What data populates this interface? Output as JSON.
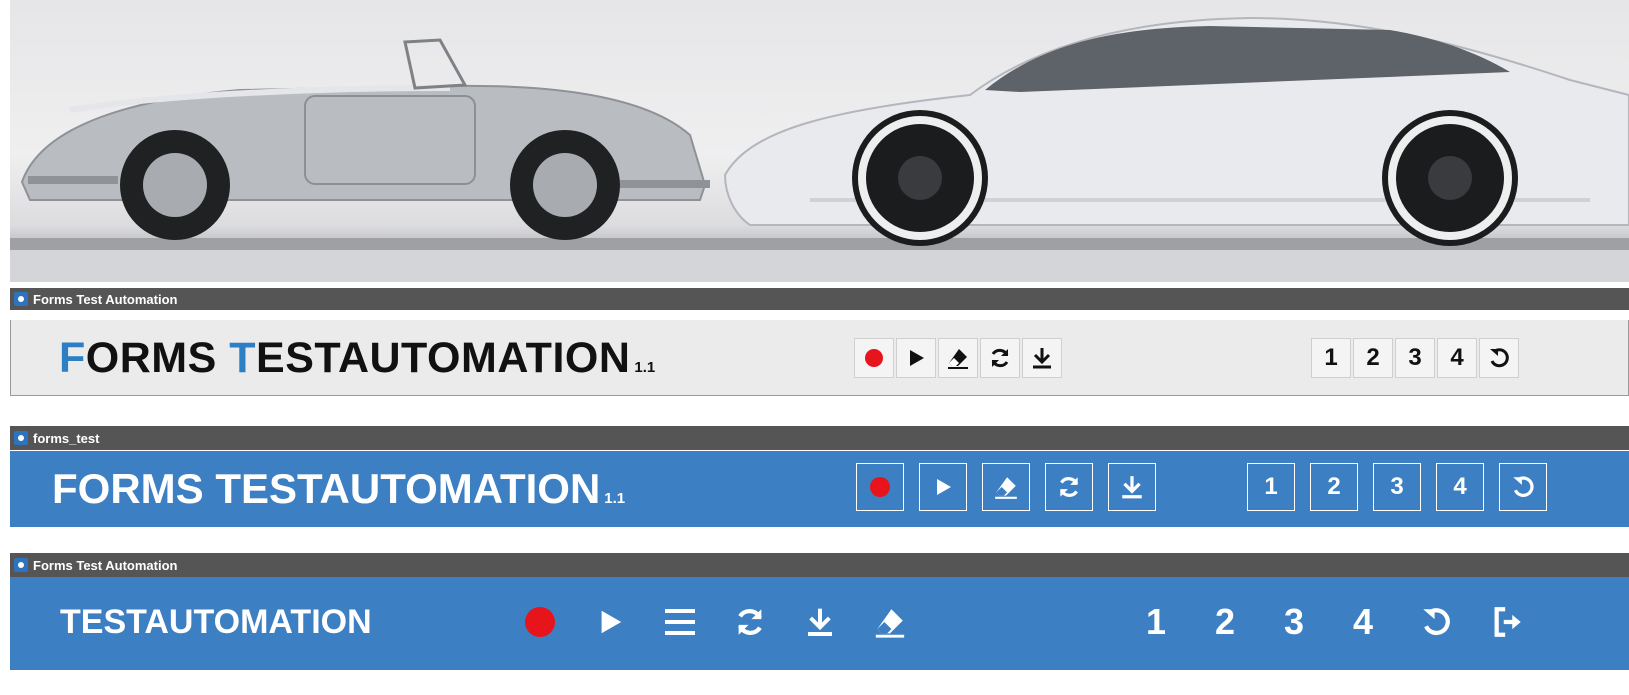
{
  "hero": {
    "description_icon": "car-photo-banner"
  },
  "window1": {
    "title": "Forms Test Automation",
    "heading_first_letter_1": "F",
    "heading_rest_1": "ORMS ",
    "heading_first_letter_2": "T",
    "heading_rest_2": "ESTAUTOMATION",
    "version": "1.1",
    "toolbar_icons": [
      "record-icon",
      "play-icon",
      "eraser-icon",
      "refresh-icon",
      "download-icon"
    ],
    "numbers": [
      "1",
      "2",
      "3",
      "4"
    ],
    "reset_icon": "undo-icon"
  },
  "window2": {
    "title": "forms_test",
    "heading": "FORMS TESTAUTOMATION",
    "version": "1.1",
    "toolbar_icons": [
      "record-icon",
      "play-icon",
      "eraser-icon",
      "refresh-icon",
      "download-icon"
    ],
    "numbers": [
      "1",
      "2",
      "3",
      "4"
    ],
    "reset_icon": "undo-icon"
  },
  "window3": {
    "title": "Forms Test Automation",
    "heading": "TESTAUTOMATION",
    "toolbar_icons": [
      "record-icon",
      "play-icon",
      "menu-icon",
      "refresh-icon",
      "download-icon",
      "eraser-icon"
    ],
    "numbers": [
      "1",
      "2",
      "3",
      "4"
    ],
    "reset_icon": "undo-icon",
    "exit_icon": "logout-icon"
  },
  "colors": {
    "accent_blue": "#2c7fc3",
    "panel_blue": "#3d7fc3",
    "titlebar": "#555555",
    "record_red": "#e8141c"
  }
}
